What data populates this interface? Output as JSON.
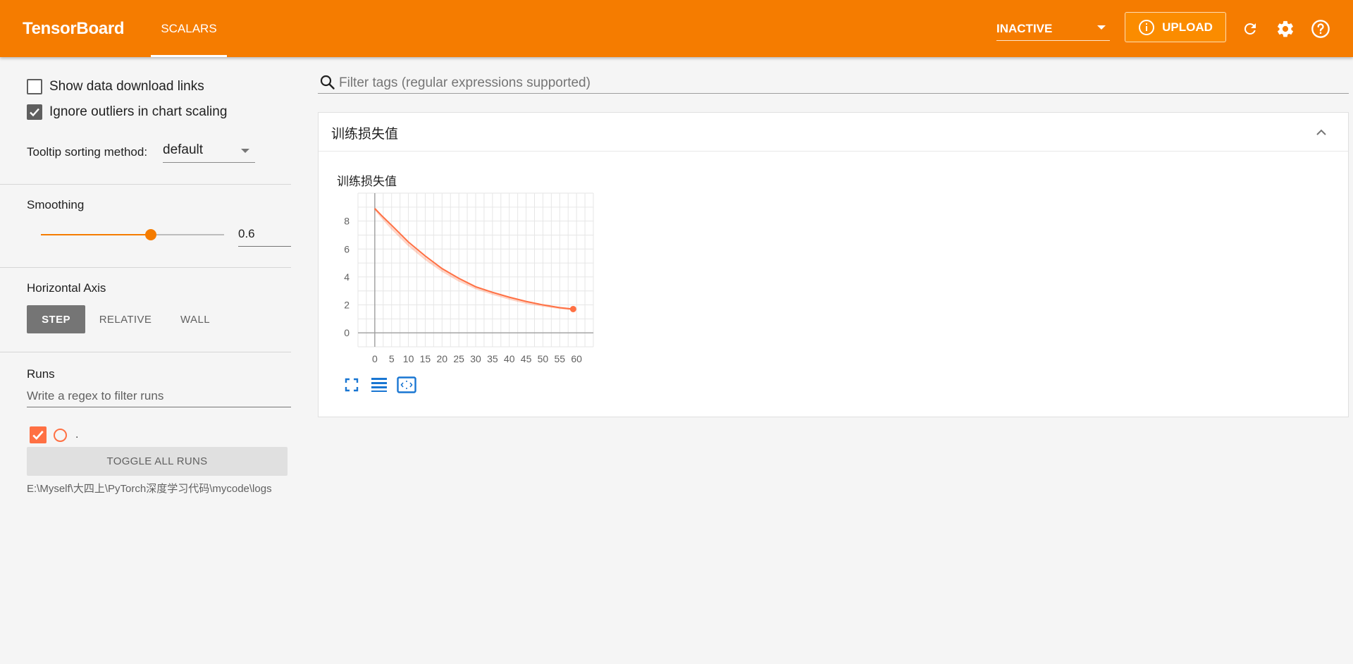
{
  "header": {
    "brand": "TensorBoard",
    "tabs": [
      {
        "label": "SCALARS",
        "active": true
      }
    ],
    "run_status": "INACTIVE",
    "upload_label": "UPLOAD",
    "icons": [
      "refresh-icon",
      "settings-gear-icon",
      "help-icon"
    ],
    "accent": "#f57c00"
  },
  "sidebar": {
    "show_download_links": {
      "label": "Show data download links",
      "checked": false
    },
    "ignore_outliers": {
      "label": "Ignore outliers in chart scaling",
      "checked": true
    },
    "tooltip_sorting": {
      "label": "Tooltip sorting method:",
      "value": "default"
    },
    "smoothing": {
      "label": "Smoothing",
      "value": "0.6",
      "fraction": 0.6
    },
    "horizontal_axis": {
      "label": "Horizontal Axis",
      "options": [
        "STEP",
        "RELATIVE",
        "WALL"
      ],
      "selected": "STEP"
    },
    "runs": {
      "label": "Runs",
      "filter_placeholder": "Write a regex to filter runs",
      "items": [
        {
          "name": ".",
          "checked": true,
          "color": "#ff7043"
        }
      ],
      "toggle_all_label": "TOGGLE ALL RUNS",
      "logdir": "E:\\Myself\\大四上\\PyTorch深度学习代码\\mycode\\logs"
    }
  },
  "main": {
    "filter_placeholder": "Filter tags (regular expressions supported)",
    "card": {
      "title": "训练损失值",
      "chart_title": "训练损失值"
    }
  },
  "chart_data": {
    "type": "line",
    "title": "训练损失值",
    "xlabel": "",
    "ylabel": "",
    "xlim": [
      -5,
      65
    ],
    "ylim": [
      -1,
      10
    ],
    "x_ticks": [
      0,
      5,
      10,
      15,
      20,
      25,
      30,
      35,
      40,
      45,
      50,
      55,
      60
    ],
    "y_ticks": [
      0,
      2,
      4,
      6,
      8
    ],
    "grid": true,
    "series": [
      {
        "color": "#ff7043",
        "x": [
          0,
          2,
          5,
          10,
          15,
          20,
          25,
          30,
          35,
          40,
          45,
          50,
          55,
          59
        ],
        "y": [
          8.9,
          8.4,
          7.7,
          6.5,
          5.5,
          4.6,
          3.9,
          3.3,
          2.9,
          2.55,
          2.25,
          2.0,
          1.8,
          1.7
        ],
        "raw_y": [
          8.9,
          8.3,
          7.5,
          6.3,
          5.3,
          4.45,
          3.75,
          3.2,
          2.8,
          2.45,
          2.15,
          1.95,
          1.78,
          1.68
        ]
      }
    ]
  }
}
